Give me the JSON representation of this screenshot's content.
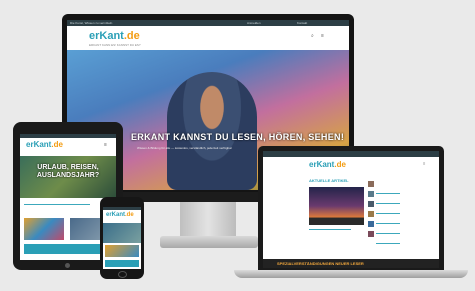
{
  "brand": {
    "logo_main": "erKant",
    "logo_tld": ".de",
    "tagline": "ERKANT KANN ES! KANNST DU ES?"
  },
  "monitor": {
    "topbar": [
      "Die Kunst, Wissen zu vermitteln",
      "Anmelden",
      "Kontakt"
    ],
    "hero_title": "ERKANT KANNST DU LESEN, HÖREN, SEHEN!",
    "hero_subtitle": "Wissen & Bildung für alle — kostenlos, verständlich, jederzeit verfügbar"
  },
  "tablet": {
    "hero_title": "URLAUB, REISEN, AUSLANDSJAHR?"
  },
  "laptop": {
    "section_title": "AKTUELLE ARTIKEL",
    "footer_text": "SPEZIALVERSTÄNDIGUNGEN NEUER LESER"
  },
  "colors": {
    "accent": "#2a9fb6",
    "brand_orange": "#f39c12",
    "dark_bar": "#2c3e45"
  }
}
